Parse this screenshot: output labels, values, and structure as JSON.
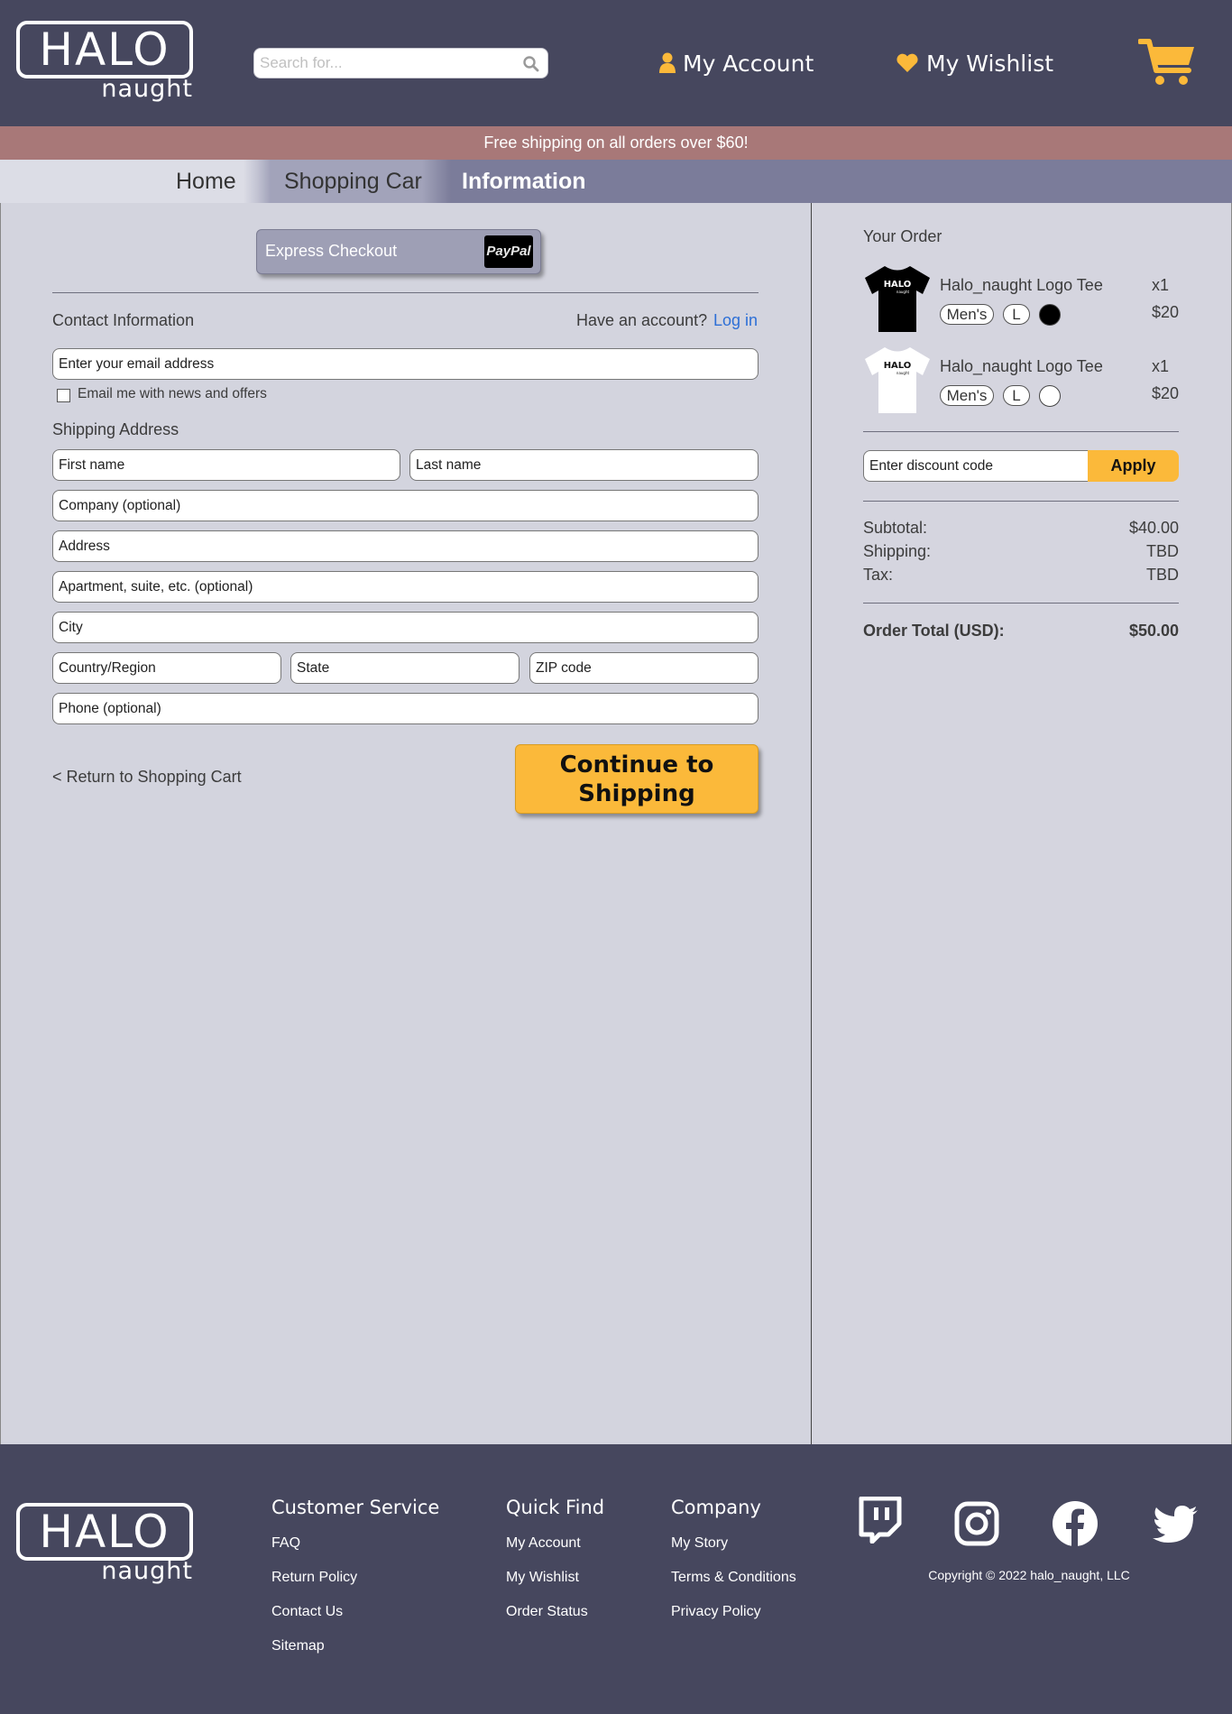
{
  "header": {
    "logo_big": "HALO",
    "logo_small": "naught",
    "search_placeholder": "Search for...",
    "account_label": "My Account",
    "wishlist_label": "My Wishlist",
    "accent_color": "#fbb93a"
  },
  "promo": "Free shipping on all orders over $60!",
  "breadcrumb": {
    "home": "Home",
    "cart": "Shopping Cart",
    "current": "Information"
  },
  "checkout": {
    "express_label": "Express Checkout",
    "paypal_label": "PayPal",
    "contact_heading": "Contact Information",
    "have_account": "Have an account?",
    "login_link": "Log in",
    "email_placeholder": "Enter your email address",
    "newsletter_label": "Email me with news and offers",
    "shipping_heading": "Shipping Address",
    "first_name": "First name",
    "last_name": "Last name",
    "company": "Company (optional)",
    "address": "Address",
    "apartment": "Apartment, suite, etc. (optional)",
    "city": "City",
    "country": "Country/Region",
    "state": "State",
    "zip": "ZIP code",
    "phone": "Phone (optional)",
    "return_link": "< Return to Shopping Cart",
    "continue_line1": "Continue to",
    "continue_line2": "Shipping"
  },
  "order": {
    "title": "Your Order",
    "items": [
      {
        "name": "Halo_naught Logo Tee",
        "qty": "x1",
        "price": "$20",
        "style": "Men's",
        "size": "L",
        "color": "#000000",
        "shirt_color": "black"
      },
      {
        "name": "Halo_naught Logo Tee",
        "qty": "x1",
        "price": "$20",
        "style": "Men's",
        "size": "L",
        "color": "#ffffff",
        "shirt_color": "white"
      }
    ],
    "discount_placeholder": "Enter discount code",
    "apply_label": "Apply",
    "subtotal_label": "Subtotal:",
    "subtotal_value": "$40.00",
    "shipping_label": "Shipping:",
    "shipping_value": "TBD",
    "tax_label": "Tax:",
    "tax_value": "TBD",
    "total_label": "Order Total (USD):",
    "total_value": "$50.00"
  },
  "footer": {
    "logo_big": "HALO",
    "logo_small": "naught",
    "customer_service": {
      "heading": "Customer Service",
      "links": [
        "FAQ",
        "Return Policy",
        "Contact Us",
        "Sitemap"
      ]
    },
    "quick_find": {
      "heading": "Quick Find",
      "links": [
        "My Account",
        "My Wishlist",
        "Order Status"
      ]
    },
    "company": {
      "heading": "Company",
      "links": [
        "My Story",
        "Terms & Conditions",
        "Privacy Policy"
      ]
    },
    "social_icons": [
      "twitch-icon",
      "instagram-icon",
      "facebook-icon",
      "twitter-icon"
    ],
    "copyright": "Copyright © 2022 halo_naught, LLC"
  }
}
